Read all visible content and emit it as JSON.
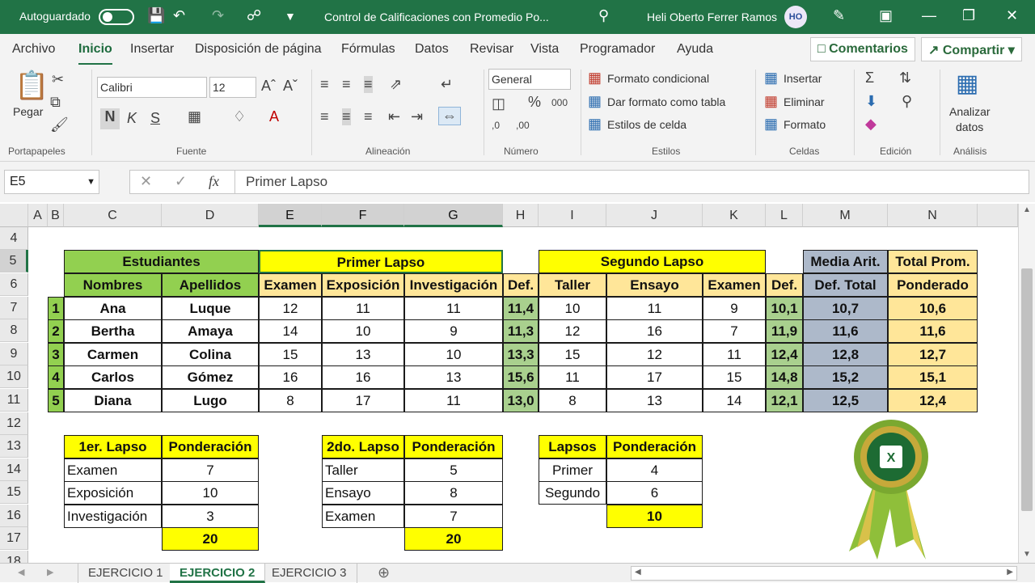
{
  "titlebar": {
    "autosave_label": "Autoguardado",
    "doc_title": "Control de Calificaciones con Promedio Po...",
    "user_name": "Heli Oberto Ferrer Ramos",
    "avatar_initials": "HO"
  },
  "menu": {
    "items": [
      "Archivo",
      "Inicio",
      "Insertar",
      "Disposición de página",
      "Fórmulas",
      "Datos",
      "Revisar",
      "Vista",
      "Programador",
      "Ayuda"
    ],
    "comments_label": "Comentarios",
    "share_label": "Compartir"
  },
  "ribbon": {
    "paste_label": "Pegar",
    "font_name": "Calibri",
    "font_size": "12",
    "bold": "N",
    "italic": "K",
    "underline": "S",
    "number_format": "General",
    "conditional_format": "Formato condicional",
    "format_as_table": "Dar formato como tabla",
    "cell_styles": "Estilos de celda",
    "insert": "Insertar",
    "delete": "Eliminar",
    "format": "Formato",
    "analyze_line1": "Analizar",
    "analyze_line2": "datos",
    "groups": {
      "clipboard": "Portapapeles",
      "font": "Fuente",
      "alignment": "Alineación",
      "number": "Número",
      "styles": "Estilos",
      "cells": "Celdas",
      "editing": "Edición",
      "analysis": "Análisis"
    }
  },
  "formula_bar": {
    "name_box": "E5",
    "formula": "Primer Lapso"
  },
  "columns": [
    "A",
    "B",
    "C",
    "D",
    "E",
    "F",
    "G",
    "H",
    "I",
    "J",
    "K",
    "L",
    "M",
    "N"
  ],
  "rows": [
    "4",
    "5",
    "6",
    "7",
    "8",
    "9",
    "10",
    "11",
    "12",
    "13",
    "14",
    "15",
    "16",
    "17",
    "18"
  ],
  "headers": {
    "estudiantes": "Estudiantes",
    "primer_lapso": "Primer Lapso",
    "segundo_lapso": "Segundo Lapso",
    "media_arit": "Media Arit.",
    "total_prom": "Total Prom.",
    "nombres": "Nombres",
    "apellidos": "Apellidos",
    "examen": "Examen",
    "exposicion": "Exposición",
    "investigacion": "Investigación",
    "def": "Def.",
    "taller": "Taller",
    "ensayo": "Ensayo",
    "examen2": "Examen",
    "def2": "Def.",
    "def_total": "Def. Total",
    "ponderado": "Ponderado"
  },
  "students": [
    {
      "n": "1",
      "nombre": "Ana",
      "apellido": "Luque",
      "examen": "12",
      "exposicion": "11",
      "investigacion": "11",
      "def1": "11,4",
      "taller": "10",
      "ensayo": "11",
      "examen2": "9",
      "def2": "10,1",
      "media": "10,7",
      "total": "10,6"
    },
    {
      "n": "2",
      "nombre": "Bertha",
      "apellido": "Amaya",
      "examen": "14",
      "exposicion": "10",
      "investigacion": "9",
      "def1": "11,3",
      "taller": "12",
      "ensayo": "16",
      "examen2": "7",
      "def2": "11,9",
      "media": "11,6",
      "total": "11,6"
    },
    {
      "n": "3",
      "nombre": "Carmen",
      "apellido": "Colina",
      "examen": "15",
      "exposicion": "13",
      "investigacion": "10",
      "def1": "13,3",
      "taller": "15",
      "ensayo": "12",
      "examen2": "11",
      "def2": "12,4",
      "media": "12,8",
      "total": "12,7"
    },
    {
      "n": "4",
      "nombre": "Carlos",
      "apellido": "Gómez",
      "examen": "16",
      "exposicion": "16",
      "investigacion": "13",
      "def1": "15,6",
      "taller": "11",
      "ensayo": "17",
      "examen2": "15",
      "def2": "14,8",
      "media": "15,2",
      "total": "15,1"
    },
    {
      "n": "5",
      "nombre": "Diana",
      "apellido": "Lugo",
      "examen": "8",
      "exposicion": "17",
      "investigacion": "11",
      "def1": "13,0",
      "taller": "8",
      "ensayo": "13",
      "examen2": "14",
      "def2": "12,1",
      "media": "12,5",
      "total": "12,4"
    }
  ],
  "table1": {
    "h1": "1er. Lapso",
    "h2": "Ponderación",
    "rows": [
      [
        "Examen",
        "7"
      ],
      [
        "Exposición",
        "10"
      ],
      [
        "Investigación",
        "3"
      ]
    ],
    "total": "20"
  },
  "table2": {
    "h1": "2do. Lapso",
    "h2": "Ponderación",
    "rows": [
      [
        "Taller",
        "5"
      ],
      [
        "Ensayo",
        "8"
      ],
      [
        "Examen",
        "7"
      ]
    ],
    "total": "20"
  },
  "table3": {
    "h1": "Lapsos",
    "h2": "Ponderación",
    "rows": [
      [
        "Primer",
        "4"
      ],
      [
        "Segundo",
        "6"
      ]
    ],
    "total": "10"
  },
  "sheets": [
    "EJERCICIO 1",
    "EJERCICIO 2",
    "EJERCICIO 3"
  ]
}
